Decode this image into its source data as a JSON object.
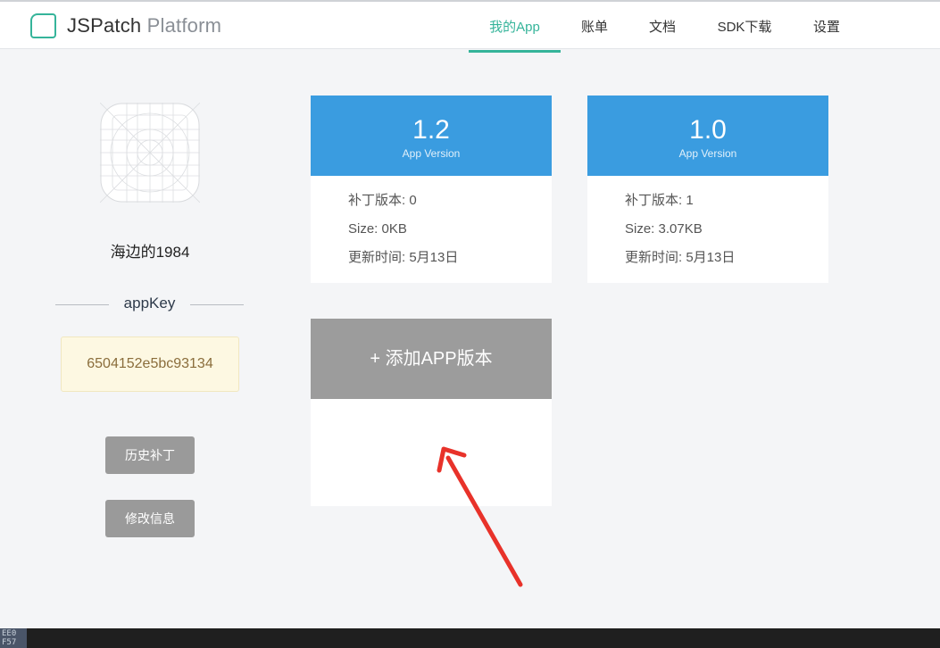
{
  "header": {
    "brand_main": "JSPatch",
    "brand_sub": "Platform",
    "accent": "#35b49a",
    "nav": [
      {
        "label": "我的App",
        "active": true
      },
      {
        "label": "账单"
      },
      {
        "label": "文档"
      },
      {
        "label": "SDK下载"
      },
      {
        "label": "设置"
      }
    ]
  },
  "sidebar": {
    "app_name": "海边的1984",
    "appkey_label": "appKey",
    "appkey_value": "6504152e5bc93134",
    "buttons": {
      "history": "历史补丁",
      "edit": "修改信息"
    }
  },
  "versions": [
    {
      "version": "1.2",
      "sub": "App Version",
      "patch": "补丁版本: 0",
      "size": "Size: 0KB",
      "updated": "更新时间: 5月13日"
    },
    {
      "version": "1.0",
      "sub": "App Version",
      "patch": "补丁版本: 1",
      "size": "Size: 3.07KB",
      "updated": "更新时间: 5月13日"
    }
  ],
  "add_version": "+ 添加APP版本",
  "colors": {
    "card_header": "#3a9ce0",
    "add_header": "#9c9c9c",
    "annotation_arrow": "#e8322a"
  },
  "bottom_corner": [
    "EE0",
    "F57"
  ]
}
